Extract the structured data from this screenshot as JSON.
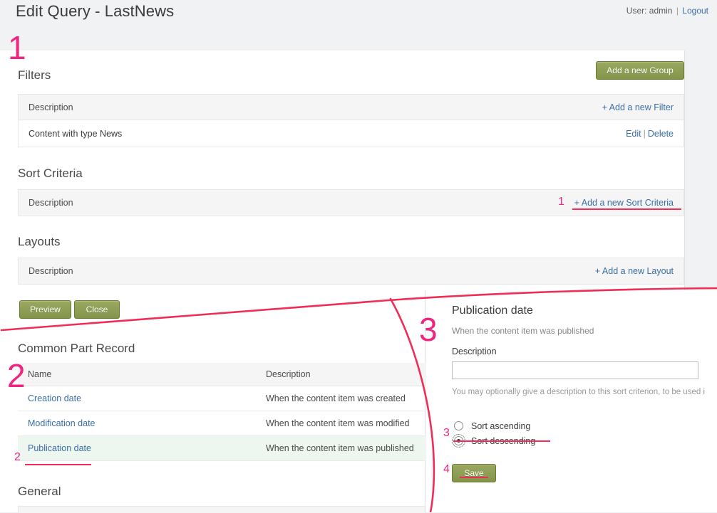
{
  "header": {
    "title": "Edit Query - LastNews",
    "user_prefix": "User: admin",
    "separator": "|",
    "logout_label": "Logout"
  },
  "filters": {
    "heading": "Filters",
    "add_group_button": "Add a new Group",
    "column_header": "Description",
    "add_filter_link": "+ Add a new Filter",
    "rows": [
      {
        "description": "Content with type News",
        "edit_label": "Edit",
        "delete_label": "Delete"
      }
    ]
  },
  "sort_criteria": {
    "heading": "Sort Criteria",
    "column_header": "Description",
    "add_link": "+ Add a new Sort Criteria"
  },
  "layouts": {
    "heading": "Layouts",
    "column_header": "Description",
    "add_link": "+ Add a new Layout"
  },
  "actions": {
    "preview_label": "Preview",
    "close_label": "Close"
  },
  "common_part_record": {
    "heading": "Common Part Record",
    "columns": [
      "Name",
      "Description"
    ],
    "rows": [
      {
        "name": "Creation date",
        "description": "When the content item was created",
        "selected": false
      },
      {
        "name": "Modification date",
        "description": "When the content item was modified",
        "selected": false
      },
      {
        "name": "Publication date",
        "description": "When the content item was published",
        "selected": true
      }
    ]
  },
  "general": {
    "heading": "General"
  },
  "sort_form": {
    "title": "Publication date",
    "subtitle": "When the content item was published",
    "description_label": "Description",
    "description_value": "",
    "description_placeholder": "",
    "description_hint": "You may optionally give a description to this sort criterion, to be used i",
    "radio_ascending": "Sort ascending",
    "radio_descending": "Sort descending",
    "selected_direction": "Sort descending",
    "save_label": "Save"
  },
  "annotations": {
    "step1": "1",
    "step1_inline": "1",
    "step2": "2",
    "step2_inline": "2",
    "step3": "3",
    "step3_inline": "3",
    "step4": "4",
    "accent_color": "#ef2d56",
    "marker_color": "#f0257f"
  }
}
